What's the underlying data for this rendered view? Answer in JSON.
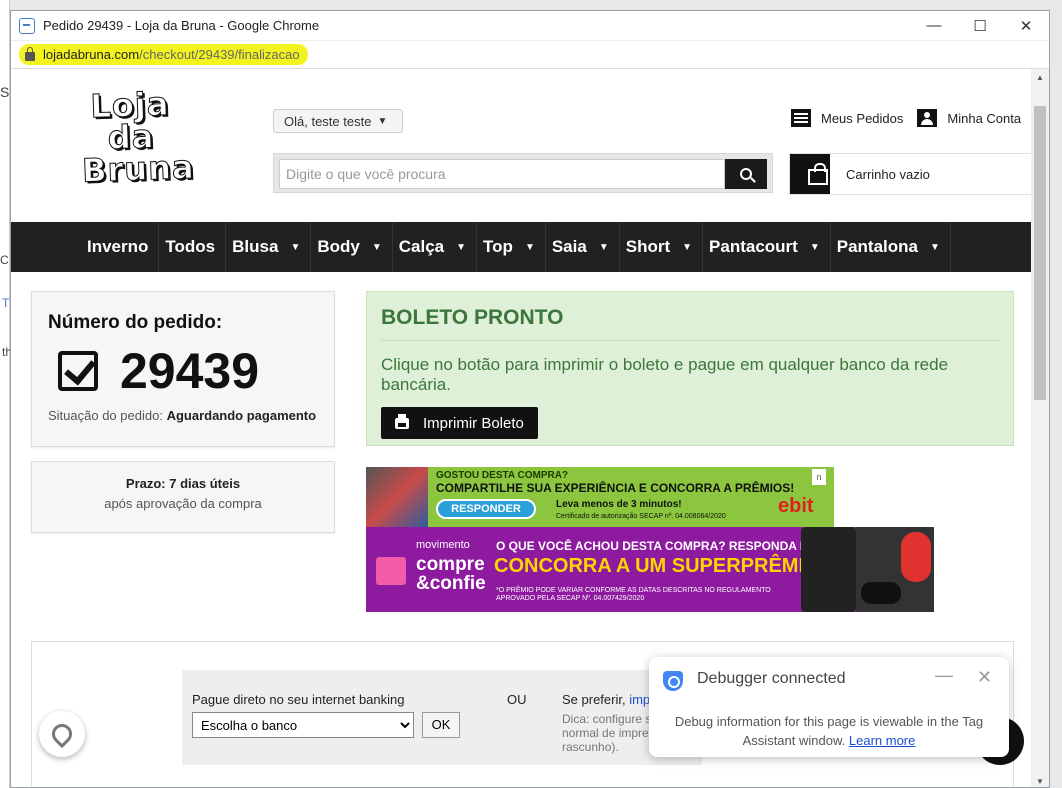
{
  "browser": {
    "tab_title": "Pedido 29439 - Loja da Bruna - Google Chrome",
    "url_domain": "lojadabruna.com",
    "url_path": "/checkout/29439/finalizacao",
    "minimize": "—",
    "maximize": "☐",
    "close": "✕"
  },
  "header": {
    "logo_lines": [
      "Loja",
      "da",
      "Bruna"
    ],
    "greeting": "Olá, teste teste",
    "search_placeholder": "Digite o que você procura",
    "my_orders": "Meus Pedidos",
    "my_account": "Minha Conta",
    "cart": "Carrinho vazio"
  },
  "nav": {
    "items": [
      {
        "label": "Inverno",
        "dropdown": false
      },
      {
        "label": "Todos",
        "dropdown": false
      },
      {
        "label": "Blusa",
        "dropdown": true
      },
      {
        "label": "Body",
        "dropdown": true
      },
      {
        "label": "Calça",
        "dropdown": true
      },
      {
        "label": "Top",
        "dropdown": true
      },
      {
        "label": "Saia",
        "dropdown": true
      },
      {
        "label": "Short",
        "dropdown": true
      },
      {
        "label": "Pantacourt",
        "dropdown": true
      },
      {
        "label": "Pantalona",
        "dropdown": true
      }
    ]
  },
  "order": {
    "label": "Número do pedido:",
    "number": "29439",
    "status_label": "Situação do pedido:",
    "status_value": "Aguardando pagamento",
    "deadline_label": "Prazo:",
    "deadline_value": "7 dias úteis",
    "deadline_note": "após aprovação da compra"
  },
  "boleto": {
    "title": "BOLETO PRONTO",
    "description": "Clique no botão para imprimir o boleto e pague em qualquer banco da rede bancária.",
    "button": "Imprimir Boleto"
  },
  "banner_ebit": {
    "line1": "GOSTOU DESTA COMPRA?",
    "line2": "COMPARTILHE SUA EXPERIÊNCIA E CONCORRA A PRÊMIOS!",
    "button": "RESPONDER",
    "line3": "Leva menos de 3 minutos!",
    "line4": "Certificado de autorização SECAP nº. 04.008064/2020",
    "brand_e": "e",
    "brand_rest": "bit",
    "badge": "n"
  },
  "banner_cc": {
    "movimento": "movimento",
    "compre": "compre",
    "confie": "&confie",
    "q1": "O QUE VOCÊ ACHOU DESTA COMPRA? RESPONDA E",
    "q2": "CONCORRA A UM SUPERPRÊMIO!",
    "q3": "*O PRÊMIO PODE VARIAR CONFORME AS DATAS DESCRITAS NO REGULAMENTO APROVADO PELA SECAP Nº. 04.007429/2020"
  },
  "bank": {
    "label": "Pague direto no seu internet banking",
    "select_value": "Escolha o banco",
    "ok": "OK",
    "or": "OU",
    "prefer": "Se preferir,",
    "prefer_link": "impr",
    "tip": "Dica: configure s normal de impre rascunho)."
  },
  "debugger": {
    "title": "Debugger connected",
    "body": "Debug information for this page is viewable in the Tag Assistant window.",
    "link": "Learn more",
    "minimize": "—",
    "close": "✕"
  },
  "background_window": {
    "t1": "Sc",
    "t2": "C",
    "t3": "T",
    "t4": "th"
  }
}
